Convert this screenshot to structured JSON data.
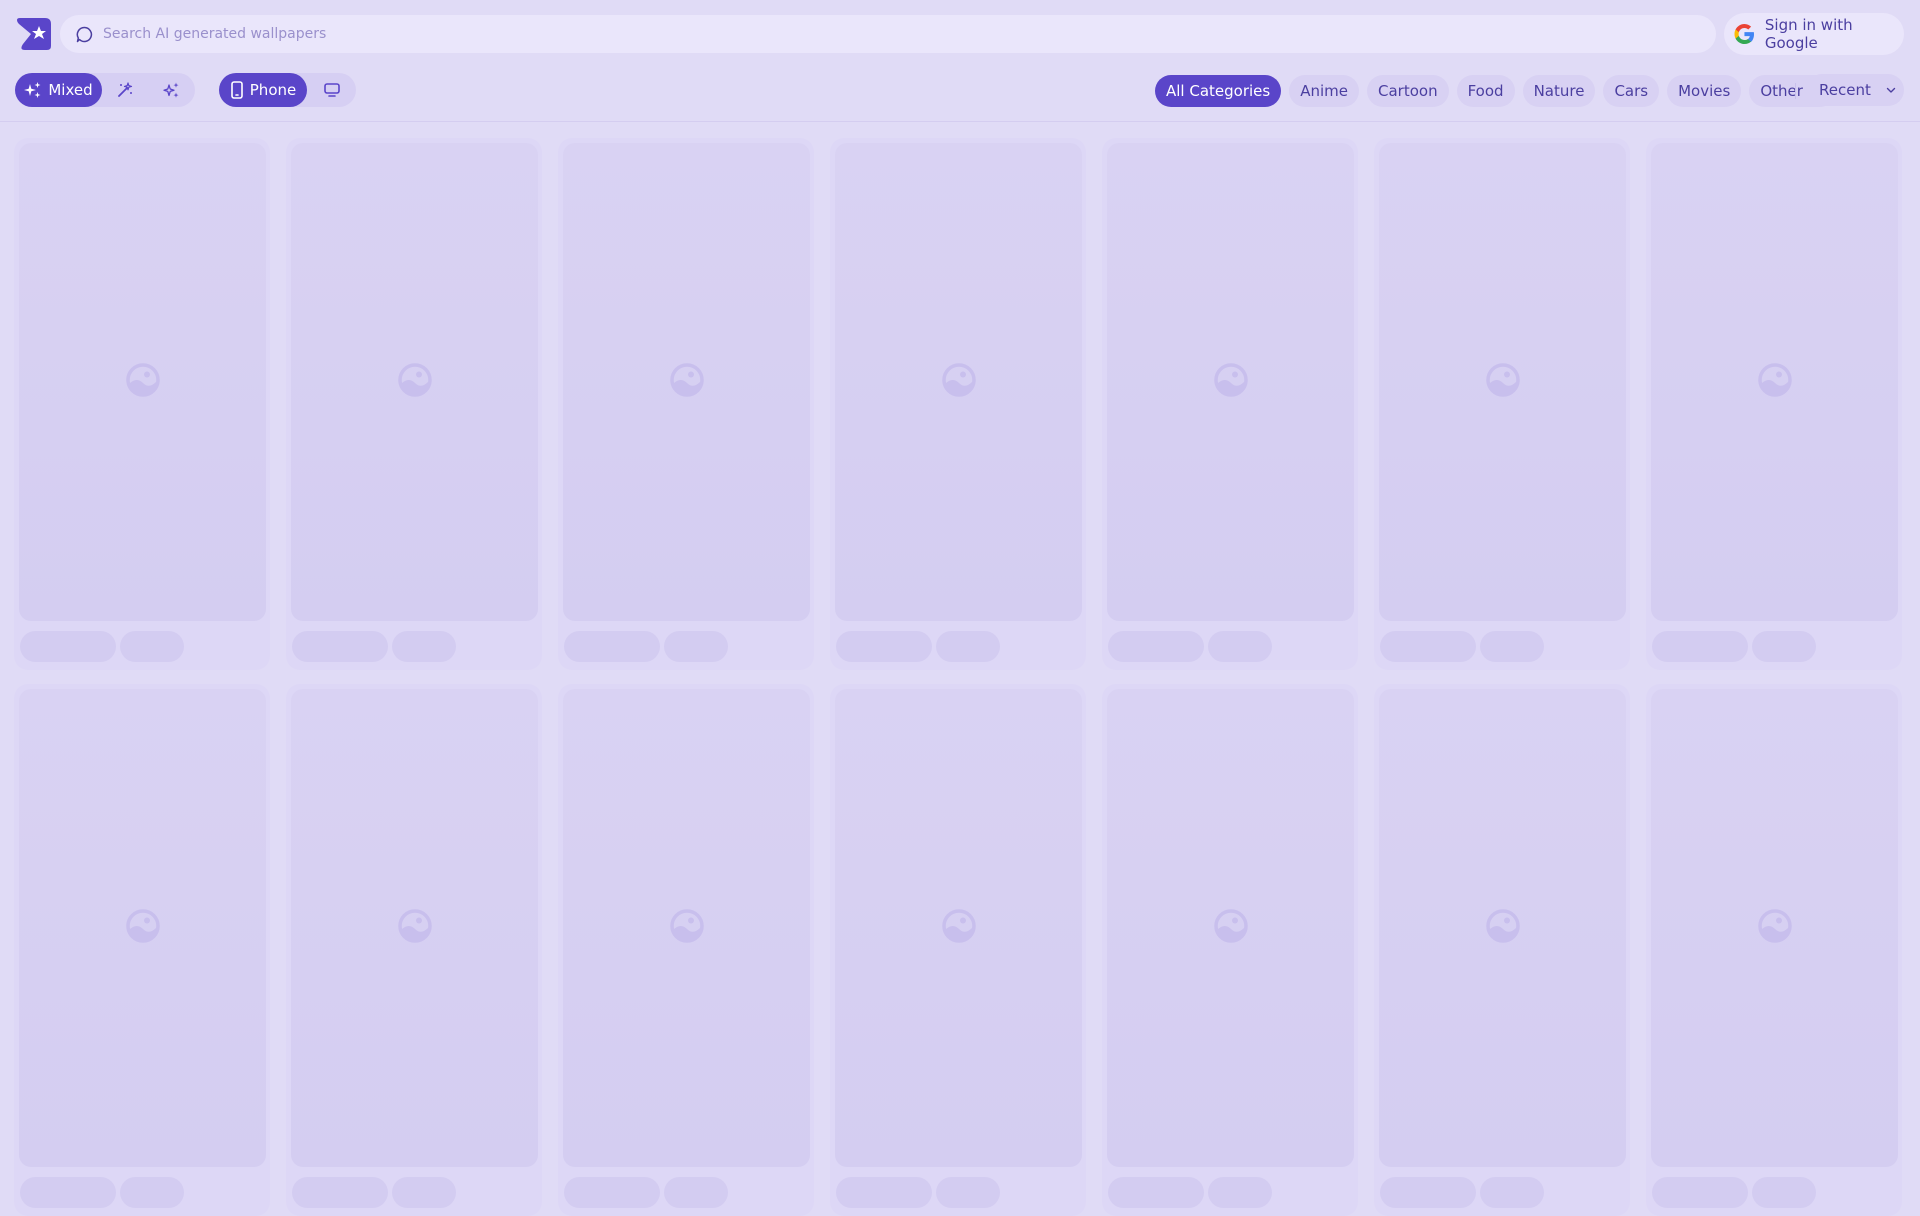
{
  "search": {
    "placeholder": "Search AI generated wallpapers"
  },
  "auth": {
    "signin_label": "Sign in with Google"
  },
  "style_modes": [
    {
      "label": "Mixed",
      "icon": "sparkles-icon",
      "active": true
    },
    {
      "label": "",
      "icon": "magic-wand-icon",
      "active": false
    },
    {
      "label": "",
      "icon": "stars-icon",
      "active": false
    }
  ],
  "device_modes": [
    {
      "label": "Phone",
      "icon": "phone-icon",
      "active": true
    },
    {
      "label": "",
      "icon": "desktop-icon",
      "active": false
    }
  ],
  "categories": [
    {
      "label": "All Categories",
      "active": true
    },
    {
      "label": "Anime",
      "active": false
    },
    {
      "label": "Cartoon",
      "active": false
    },
    {
      "label": "Food",
      "active": false
    },
    {
      "label": "Nature",
      "active": false
    },
    {
      "label": "Cars",
      "active": false
    },
    {
      "label": "Movies",
      "active": false
    },
    {
      "label": "Other",
      "active": false,
      "dropdown": true
    }
  ],
  "sort": {
    "label": "Recent"
  },
  "colors": {
    "accent": "#5a45c9",
    "background": "#e0dbf6",
    "text": "#4b3fa0"
  },
  "grid": {
    "columns": 7,
    "rows": 2,
    "loading": true
  }
}
